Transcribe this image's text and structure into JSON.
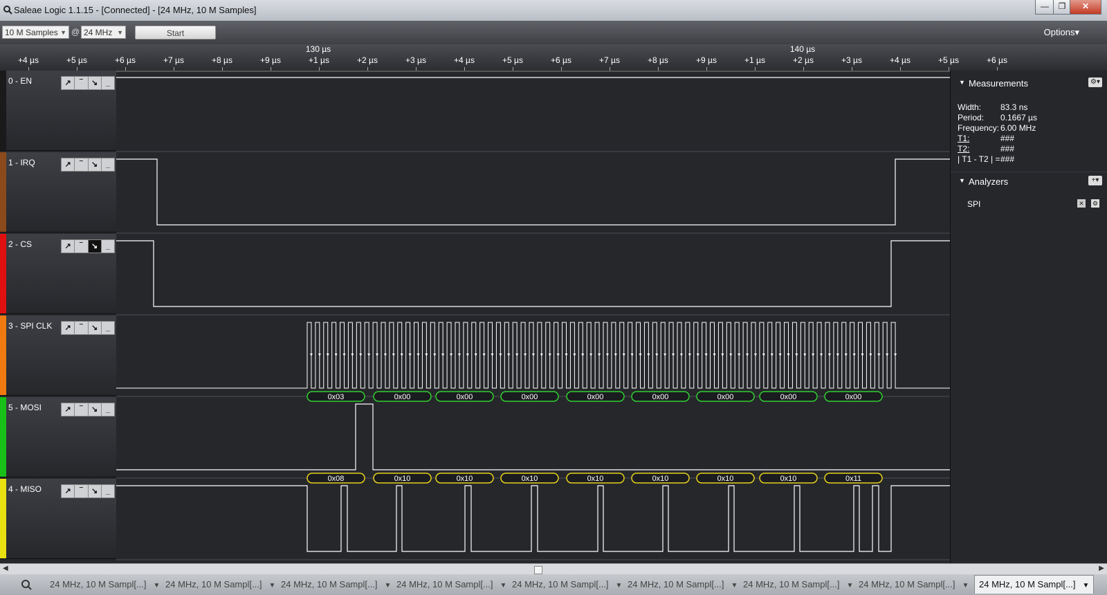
{
  "window": {
    "title": "Saleae Logic 1.1.15 - [Connected] - [24 MHz, 10 M Samples]",
    "minimize_label": "—",
    "maximize_label": "❐",
    "close_label": "✕"
  },
  "toolbar": {
    "samples_value": "10 M Samples",
    "at_symbol": "@",
    "rate_value": "24 MHz",
    "start_label": "Start",
    "options_label": "Options▾"
  },
  "ruler": {
    "ticks": [
      "+4 µs",
      "+5 µs",
      "+6 µs",
      "+7 µs",
      "+8 µs",
      "+9 µs",
      "+1 µs",
      "+2 µs",
      "+3 µs",
      "+4 µs",
      "+5 µs",
      "+6 µs",
      "+7 µs",
      "+8 µs",
      "+9 µs",
      "+1 µs",
      "+2 µs",
      "+3 µs",
      "+4 µs",
      "+5 µs",
      "+6 µs"
    ],
    "major_labels": [
      "130 µs",
      "140 µs"
    ]
  },
  "channels": [
    {
      "name": "0 - EN",
      "color": "#1a1a1a"
    },
    {
      "name": "1 - IRQ",
      "color": "#8a4a1c"
    },
    {
      "name": "2 - CS",
      "color": "#e01010"
    },
    {
      "name": "3 - SPI CLK",
      "color": "#f07a10"
    },
    {
      "name": "5 - MOSI",
      "color": "#18c018"
    },
    {
      "name": "4 - MISO",
      "color": "#e8e010"
    }
  ],
  "trigger_glyphs": [
    "↗",
    "‾",
    "↘",
    "_"
  ],
  "decodes": {
    "mosi": [
      "0x03",
      "0x00",
      "0x00",
      "0x00",
      "0x00",
      "0x00",
      "0x00",
      "0x00",
      "0x00"
    ],
    "miso": [
      "0x08",
      "0x10",
      "0x10",
      "0x10",
      "0x10",
      "0x10",
      "0x10",
      "0x10",
      "0x11"
    ],
    "mosi_color": "#2fd02f",
    "miso_color": "#e6d21c"
  },
  "measurements": {
    "header": "Measurements",
    "rows": [
      {
        "label": "Width:",
        "value": "83.3 ns"
      },
      {
        "label": "Period:",
        "value": "0.1667 µs"
      },
      {
        "label": "Frequency:",
        "value": "6.00 MHz"
      },
      {
        "label": "T1:",
        "value": "###"
      },
      {
        "label": "T2:",
        "value": "###"
      },
      {
        "label": "| T1 - T2 | =",
        "value": "###"
      }
    ]
  },
  "analyzers": {
    "header": "Analyzers",
    "add_label": "+▾",
    "items": [
      "SPI"
    ]
  },
  "tabs": {
    "labels": [
      "24 MHz, 10 M Sampl[...]",
      "24 MHz, 10 M Sampl[...]",
      "24 MHz, 10 M Sampl[...]",
      "24 MHz, 10 M Sampl[...]",
      "24 MHz, 10 M Sampl[...]",
      "24 MHz, 10 M Sampl[...]",
      "24 MHz, 10 M Sampl[...]",
      "24 MHz, 10 M Sampl[...]",
      "24 MHz, 10 M Sampl[...]"
    ],
    "active_index": 8
  }
}
